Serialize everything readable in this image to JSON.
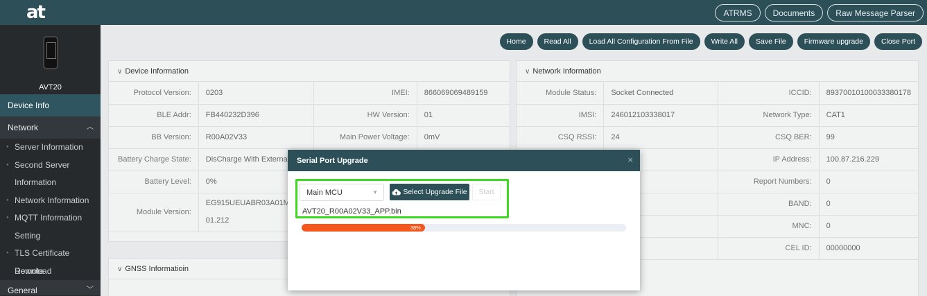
{
  "app": {
    "logo_text": "at"
  },
  "top_links": [
    "ATRMS",
    "Documents",
    "Raw Message Parser"
  ],
  "device": {
    "name": "AVT20"
  },
  "sidebar": {
    "items": [
      {
        "label": "Device Info",
        "active": true
      },
      {
        "label": "Network",
        "expanded": true
      }
    ],
    "subitems": [
      "Server Information",
      "Second Server",
      "Information",
      "Network Information",
      "MQTT Information",
      "Setting",
      "TLS Certificate Remote",
      "Download"
    ],
    "general": "General"
  },
  "toolbar": [
    "Home",
    "Read All",
    "Load All Configuration From File",
    "Write All",
    "Save File",
    "Firmware upgrade",
    "Close Port"
  ],
  "device_info": {
    "title": "Device Information",
    "rows": [
      {
        "l1": "Protocol Version:",
        "v1": "0203",
        "l2": "IMEI:",
        "v2": "866069069489159"
      },
      {
        "l1": "BLE Addr:",
        "v1": "FB440232D396",
        "l2": "HW Version:",
        "v2": "01"
      },
      {
        "l1": "BB Version:",
        "v1": "R00A02V33",
        "l2": "Main Power Voltage:",
        "v2": "0mV"
      },
      {
        "l1": "Battery Charge State:",
        "v1": "DisCharge With External Powe",
        "l2": "",
        "v2": ""
      },
      {
        "l1": "Battery Level:",
        "v1": "0%",
        "l2": "",
        "v2": ""
      }
    ],
    "module_label": "Module Version:",
    "module_value_1": "EG915UEUABR03A01M08_01",
    "module_value_2": "01.212"
  },
  "gnss": {
    "title": "GNSS Informatioin"
  },
  "network_info": {
    "title": "Network Information",
    "rows": [
      {
        "l1": "Module Status:",
        "v1": "Socket Connected",
        "l2": "ICCID:",
        "v2": "89370010100033380178"
      },
      {
        "l1": "IMSI:",
        "v1": "246012103338017",
        "l2": "Network Type:",
        "v2": "CAT1"
      },
      {
        "l1": "CSQ RSSI:",
        "v1": "24",
        "l2": "CSQ BER:",
        "v2": "99"
      },
      {
        "l1": "",
        "v1": "",
        "l2": "IP Address:",
        "v2": "100.87.216.229"
      },
      {
        "l1": "",
        "v1": "",
        "l2": "Report Numbers:",
        "v2": "0"
      },
      {
        "l1": "",
        "v1": "",
        "l2": "BAND:",
        "v2": "0"
      },
      {
        "l1": "",
        "v1": "",
        "l2": "MNC:",
        "v2": "0"
      },
      {
        "l1": "",
        "v1": "",
        "l2": "CEL ID:",
        "v2": "00000000"
      }
    ]
  },
  "modal": {
    "title": "Serial Port Upgrade",
    "close": "×",
    "select_value": "Main MCU",
    "upload_label": "Select Upgrade File",
    "start_label": "Start",
    "file_name": "AVT20_R00A02V33_APP.bin",
    "progress_percent": 38,
    "progress_text": "38%"
  },
  "colors": {
    "header": "#2c4f58",
    "sidebar": "#262a2d",
    "progress": "#f5581c",
    "highlight": "#3fd923"
  }
}
